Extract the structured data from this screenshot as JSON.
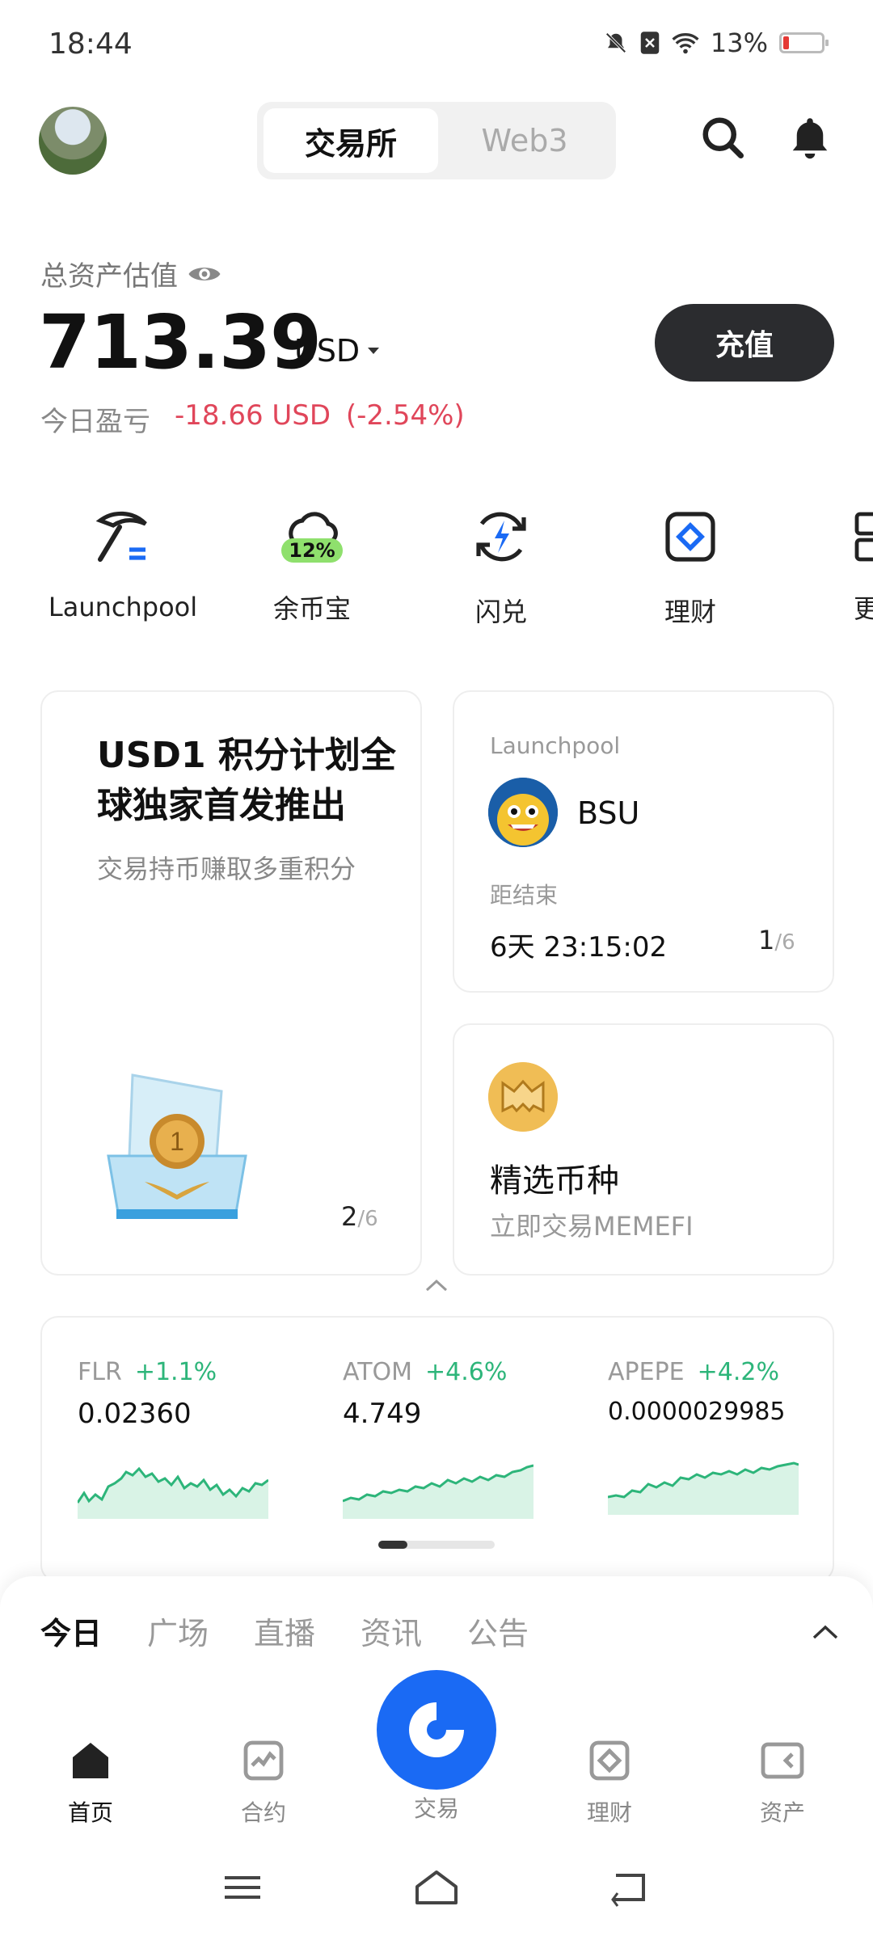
{
  "status": {
    "time": "18:44",
    "battery": "13%",
    "battery_level": 0.13
  },
  "header": {
    "tabs": [
      {
        "label": "交易所",
        "active": true
      },
      {
        "label": "Web3",
        "active": false
      }
    ]
  },
  "asset": {
    "label": "总资产估值",
    "value": "713.39",
    "currency": "USD",
    "pnl_label": "今日盈亏",
    "pnl_value": "-18.66 USD",
    "pnl_pct": "(-2.54%)",
    "recharge_label": "充值"
  },
  "shortcuts": [
    {
      "label": "Launchpool",
      "icon": "pickaxe-icon"
    },
    {
      "label": "余币宝",
      "icon": "cloud-icon",
      "badge": "12%"
    },
    {
      "label": "闪兑",
      "icon": "flash-swap-icon"
    },
    {
      "label": "理财",
      "icon": "diamond-icon"
    },
    {
      "label": "更",
      "icon": "more-grid-icon"
    }
  ],
  "promo": {
    "title": "USD1 积分计划全球独家首发推出",
    "subtitle": "交易持币赚取多重积分",
    "page": "2",
    "total": "/6"
  },
  "launchpool": {
    "label": "Launchpool",
    "coin": "BSU",
    "countdown_label": "距结束",
    "countdown": "6天 23:15:02",
    "page": "1",
    "total": "/6"
  },
  "pick": {
    "title": "精选币种",
    "subtitle": "立即交易MEMEFI"
  },
  "tickers": [
    {
      "name": "FLR",
      "change": "+1.1%",
      "price": "0.02360"
    },
    {
      "name": "ATOM",
      "change": "+4.6%",
      "price": "4.749"
    },
    {
      "name": "APEPE",
      "change": "+4.2%",
      "price": "0.0000029985"
    }
  ],
  "feed_tabs": [
    {
      "label": "今日",
      "active": true
    },
    {
      "label": "广场",
      "active": false
    },
    {
      "label": "直播",
      "active": false
    },
    {
      "label": "资讯",
      "active": false
    },
    {
      "label": "公告",
      "active": false
    }
  ],
  "bottom_nav": [
    {
      "label": "首页",
      "icon": "home-icon",
      "active": true
    },
    {
      "label": "合约",
      "icon": "chart-icon",
      "active": false
    },
    {
      "label": "交易",
      "icon": "trade-icon",
      "active": false
    },
    {
      "label": "理财",
      "icon": "diamond-icon",
      "active": false
    },
    {
      "label": "资产",
      "icon": "wallet-icon",
      "active": false
    }
  ],
  "colors": {
    "accent": "#1a6af4",
    "loss": "#e0465a",
    "gain": "#2db57a",
    "dark_button": "#2b2c2f"
  }
}
